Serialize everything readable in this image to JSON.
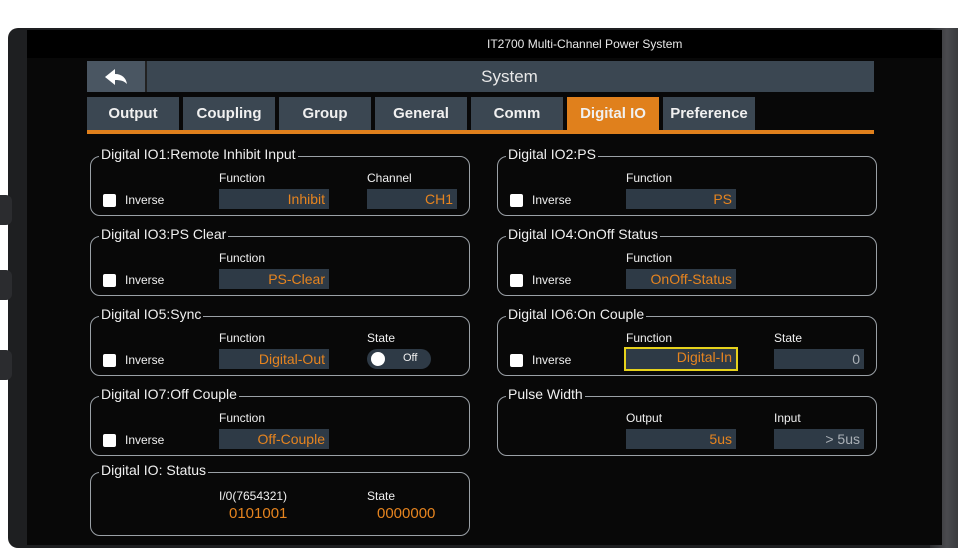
{
  "window_title": "IT2700 Multi-Channel Power System",
  "header": {
    "title": "System"
  },
  "tabs": [
    {
      "label": "Output",
      "active": false
    },
    {
      "label": "Coupling",
      "active": false
    },
    {
      "label": "Group",
      "active": false
    },
    {
      "label": "General",
      "active": false
    },
    {
      "label": "Comm",
      "active": false
    },
    {
      "label": "Digital IO",
      "active": true
    },
    {
      "label": "Preference",
      "active": false
    }
  ],
  "io1": {
    "title": "Digital IO1:Remote Inhibit Input",
    "inverse": "Inverse",
    "function_label": "Function",
    "function_value": "Inhibit",
    "channel_label": "Channel",
    "channel_value": "CH1"
  },
  "io2": {
    "title": "Digital IO2:PS",
    "inverse": "Inverse",
    "function_label": "Function",
    "function_value": "PS"
  },
  "io3": {
    "title": "Digital IO3:PS Clear",
    "inverse": "Inverse",
    "function_label": "Function",
    "function_value": "PS-Clear"
  },
  "io4": {
    "title": "Digital IO4:OnOff Status",
    "inverse": "Inverse",
    "function_label": "Function",
    "function_value": "OnOff-Status"
  },
  "io5": {
    "title": "Digital IO5:Sync",
    "inverse": "Inverse",
    "function_label": "Function",
    "function_value": "Digital-Out",
    "state_label": "State",
    "state_value": "Off"
  },
  "io6": {
    "title": "Digital IO6:On Couple",
    "inverse": "Inverse",
    "function_label": "Function",
    "function_value": "Digital-In",
    "state_label": "State",
    "state_value": "0"
  },
  "io7": {
    "title": "Digital IO7:Off Couple",
    "inverse": "Inverse",
    "function_label": "Function",
    "function_value": "Off-Couple"
  },
  "pulse": {
    "title": "Pulse Width",
    "output_label": "Output",
    "output_value": "5us",
    "input_label": "Input",
    "input_value": "> 5us"
  },
  "status": {
    "title": "Digital IO: Status",
    "io_label": "I/0(7654321)",
    "io_value": "0101001",
    "state_label": "State",
    "state_value": "0000000"
  },
  "colors": {
    "accent": "#e0801c",
    "panel": "#3b4752",
    "field": "#2e3a46",
    "selected_border": "#e6d21c"
  }
}
